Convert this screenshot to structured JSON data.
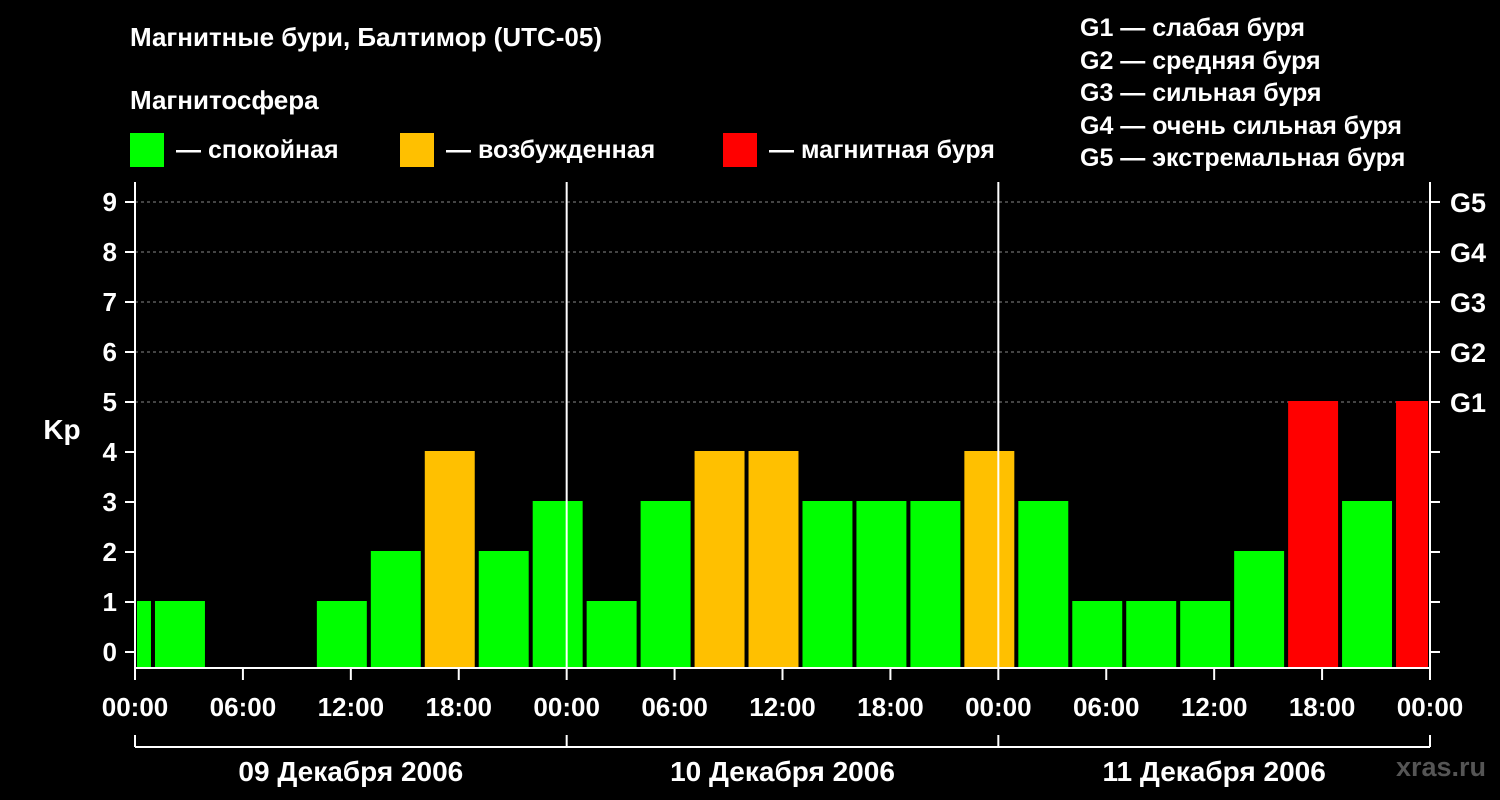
{
  "title": "Магнитные бури, Балтимор (UTC-05)",
  "subtitle": "Магнитосфера",
  "legend": [
    {
      "label": "— спокойная",
      "color": "#00ff00"
    },
    {
      "label": "— возбужденная",
      "color": "#ffc000"
    },
    {
      "label": "— магнитная буря",
      "color": "#ff0000"
    }
  ],
  "g_levels": [
    "G1 — слабая буря",
    "G2 — средняя буря",
    "G3 — сильная буря",
    "G4 — очень сильная буря",
    "G5 — экстремальная буря"
  ],
  "watermark": "xras.ru",
  "chart_data": {
    "type": "bar",
    "ylabel": "Kp",
    "ylim": [
      0,
      9
    ],
    "yticks": [
      "0",
      "1",
      "2",
      "3",
      "4",
      "5",
      "6",
      "7",
      "8",
      "9"
    ],
    "right_axis": [
      {
        "kp": 5,
        "label": "G1"
      },
      {
        "kp": 6,
        "label": "G2"
      },
      {
        "kp": 7,
        "label": "G3"
      },
      {
        "kp": 8,
        "label": "G4"
      },
      {
        "kp": 9,
        "label": "G5"
      }
    ],
    "xlim_hours": [
      0,
      72
    ],
    "xticks": [
      {
        "h": 0,
        "label": "00:00"
      },
      {
        "h": 6,
        "label": "06:00"
      },
      {
        "h": 12,
        "label": "12:00"
      },
      {
        "h": 18,
        "label": "18:00"
      },
      {
        "h": 24,
        "label": "00:00"
      },
      {
        "h": 30,
        "label": "06:00"
      },
      {
        "h": 36,
        "label": "12:00"
      },
      {
        "h": 42,
        "label": "18:00"
      },
      {
        "h": 48,
        "label": "00:00"
      },
      {
        "h": 54,
        "label": "06:00"
      },
      {
        "h": 60,
        "label": "12:00"
      },
      {
        "h": 66,
        "label": "18:00"
      },
      {
        "h": 72,
        "label": "00:00"
      }
    ],
    "days": [
      "09 Декабря 2006",
      "10 Декабря 2006",
      "11 Декабря 2006"
    ],
    "colors": {
      "quiet": "#00ff00",
      "active": "#ffc000",
      "storm": "#ff0000"
    },
    "bars": [
      {
        "start": 0,
        "end": 1,
        "kp": 1
      },
      {
        "start": 1,
        "end": 4,
        "kp": 1
      },
      {
        "start": 4,
        "end": 7,
        "kp": 0
      },
      {
        "start": 7,
        "end": 10,
        "kp": 0
      },
      {
        "start": 10,
        "end": 13,
        "kp": 1
      },
      {
        "start": 13,
        "end": 16,
        "kp": 2
      },
      {
        "start": 16,
        "end": 19,
        "kp": 4
      },
      {
        "start": 19,
        "end": 22,
        "kp": 2
      },
      {
        "start": 22,
        "end": 25,
        "kp": 3
      },
      {
        "start": 25,
        "end": 28,
        "kp": 1
      },
      {
        "start": 28,
        "end": 31,
        "kp": 3
      },
      {
        "start": 31,
        "end": 34,
        "kp": 4
      },
      {
        "start": 34,
        "end": 37,
        "kp": 4
      },
      {
        "start": 37,
        "end": 40,
        "kp": 3
      },
      {
        "start": 40,
        "end": 43,
        "kp": 3
      },
      {
        "start": 43,
        "end": 46,
        "kp": 3
      },
      {
        "start": 46,
        "end": 49,
        "kp": 4
      },
      {
        "start": 49,
        "end": 52,
        "kp": 3
      },
      {
        "start": 52,
        "end": 55,
        "kp": 1
      },
      {
        "start": 55,
        "end": 58,
        "kp": 1
      },
      {
        "start": 58,
        "end": 61,
        "kp": 1
      },
      {
        "start": 61,
        "end": 64,
        "kp": 2
      },
      {
        "start": 64,
        "end": 67,
        "kp": 5
      },
      {
        "start": 67,
        "end": 70,
        "kp": 3
      },
      {
        "start": 70,
        "end": 72,
        "kp": 5
      }
    ]
  }
}
